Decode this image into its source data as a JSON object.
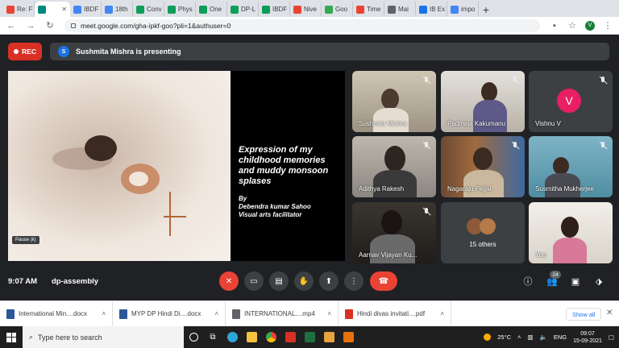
{
  "browser": {
    "tabs": [
      {
        "label": "Re: F",
        "color": "#ea4335"
      },
      {
        "label": "",
        "color": "#00897b",
        "active": true
      },
      {
        "label": "IBDF",
        "color": "#4285f4"
      },
      {
        "label": "18th",
        "color": "#4285f4"
      },
      {
        "label": "Conv",
        "color": "#0f9d58"
      },
      {
        "label": "Phys",
        "color": "#0f9d58"
      },
      {
        "label": "One",
        "color": "#0f9d58"
      },
      {
        "label": "DP-L",
        "color": "#0f9d58"
      },
      {
        "label": "IBDF",
        "color": "#0f9d58"
      },
      {
        "label": "Nive",
        "color": "#ea4335"
      },
      {
        "label": "Goo",
        "color": "#34a853"
      },
      {
        "label": "Time",
        "color": "#ea4335"
      },
      {
        "label": "Mai",
        "color": "#5f6368"
      },
      {
        "label": "IB Ex",
        "color": "#1a73e8"
      },
      {
        "label": "impo",
        "color": "#4285f4"
      }
    ],
    "new_tab": "+",
    "url": "meet.google.com/gha-ipkf-goo?pli=1&authuser=0",
    "profile_initial": "V"
  },
  "meet": {
    "rec_label": "REC",
    "presenter_initial": "S",
    "presenting_text": "Sushmita Mishra is presenting",
    "pause_label": "Pause (k)",
    "slide": {
      "title": "Expression of  my childhood memories and muddy monsoon splases",
      "byline_1": "By",
      "byline_2": "Debendra kumar Sahoo",
      "byline_3": "Visual arts facilitator"
    },
    "participants": [
      {
        "name": "Sushmita Mishra"
      },
      {
        "name": "Padmaja Kakumanu"
      },
      {
        "name": "Vishnu V",
        "initial": "V"
      },
      {
        "name": "Adithya Rakesh"
      },
      {
        "name": "Nagaraju Pejjai"
      },
      {
        "name": "Susmitha Mukherjee"
      },
      {
        "name": "Aarnav Vijayan Ku..."
      },
      {
        "name": "15 others"
      },
      {
        "name": "You"
      }
    ],
    "time": "9:07 AM",
    "meeting_code": "dp-assembly",
    "participant_count": "24"
  },
  "downloads": {
    "items": [
      {
        "name": "International Min....docx",
        "color": "#2b579a"
      },
      {
        "name": "MYP DP Hindi Di....docx",
        "color": "#2b579a"
      },
      {
        "name": "INTERNATIONAL....mp4",
        "color": "#5f6368"
      },
      {
        "name": "Hindi divas invitati....pdf",
        "color": "#d93025"
      }
    ],
    "show_all": "Show all"
  },
  "taskbar": {
    "search_placeholder": "Type here to search",
    "weather": "25°C",
    "language": "ENG",
    "time": "09:07",
    "date": "15-09-2021"
  }
}
